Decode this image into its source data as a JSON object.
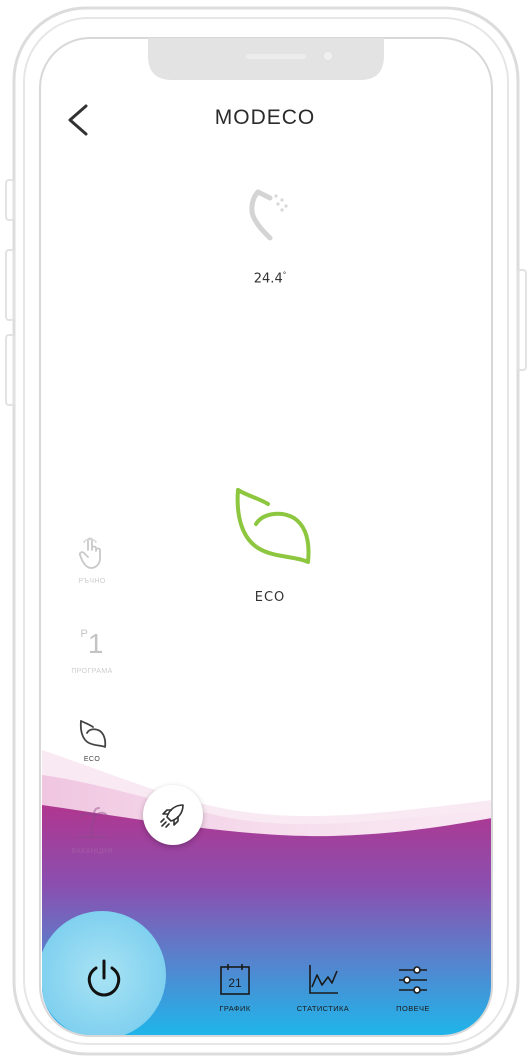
{
  "header": {
    "title": "MODECO"
  },
  "status": {
    "temperature": "24.4",
    "degree_symbol": "°",
    "shower_icon": "shower-icon"
  },
  "current_mode": {
    "label": "ECO",
    "icon": "leaf-icon",
    "color": "#8dc63f"
  },
  "modes": [
    {
      "label": "РЪЧНО",
      "icon": "hand-touch-icon",
      "active": false
    },
    {
      "label": "ПРОГРАМА",
      "icon_text_sup": "P",
      "icon_text": "1",
      "active": false
    },
    {
      "label": "ECO",
      "icon": "leaf-icon",
      "active": true
    },
    {
      "label": "ВАКАНЦИЯ",
      "icon": "palm-beach-icon",
      "active": false
    }
  ],
  "boost": {
    "icon": "rocket-icon"
  },
  "power": {
    "icon": "power-icon"
  },
  "nav": {
    "schedule": {
      "label": "ГРАФИК",
      "day": "21",
      "icon": "calendar-icon"
    },
    "stats": {
      "label": "СТАТИСТИКА",
      "icon": "chart-icon"
    },
    "more": {
      "label": "ПОВЕЧЕ",
      "icon": "sliders-icon"
    }
  },
  "colors": {
    "gradient_top": "#a23a92",
    "gradient_mid": "#6a6fc0",
    "gradient_bottom": "#22b6ea",
    "power_circle": "#8fd7f0"
  }
}
